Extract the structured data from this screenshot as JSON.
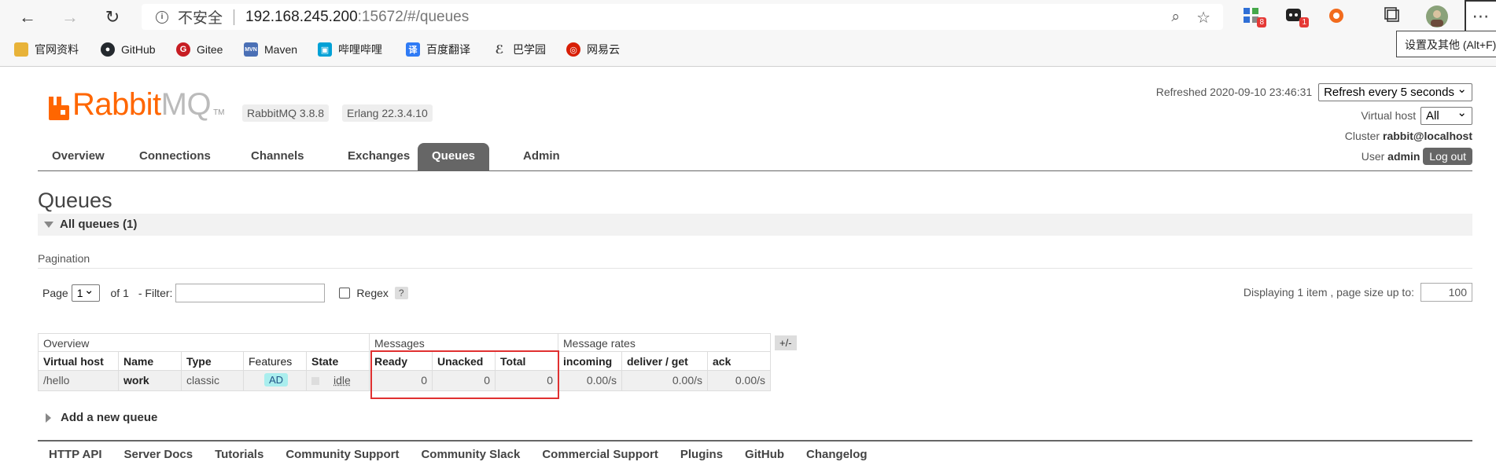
{
  "browser": {
    "address": {
      "security": "不安全",
      "host": "192.168.245.200",
      "path": ":15672/#/queues"
    },
    "extensions": [
      {
        "icon": "grid-app-icon",
        "badge": "8"
      },
      {
        "icon": "chat-icon",
        "badge": "1"
      },
      {
        "icon": "orange-circle-icon",
        "badge": ""
      }
    ],
    "menu_tooltip": "设置及其他 (Alt+F)",
    "bookmarks": [
      {
        "label": "官网资料",
        "icon": "folder-icon",
        "color": "#e8b339"
      },
      {
        "label": "GitHub",
        "icon": "github-icon",
        "color": "#24292e"
      },
      {
        "label": "Gitee",
        "icon": "gitee-icon",
        "color": "#c71d23"
      },
      {
        "label": "Maven",
        "icon": "maven-icon",
        "color": "#4a6fb5"
      },
      {
        "label": "哔哩哔哩",
        "icon": "bilibili-icon",
        "color": "#00a1d6"
      },
      {
        "label": "百度翻译",
        "icon": "translate-icon",
        "color": "#2f7bf5"
      },
      {
        "label": "巴学园",
        "icon": "bxy-icon",
        "color": "#444444"
      },
      {
        "label": "网易云",
        "icon": "netease-icon",
        "color": "#d81e06"
      }
    ]
  },
  "app": {
    "logo_main": "Rabbit",
    "logo_mq": "MQ",
    "logo_tm": "TM",
    "version": "RabbitMQ 3.8.8",
    "erlang": "Erlang 22.3.4.10",
    "refreshed_label": "Refreshed 2020-09-10 23:46:31",
    "refresh_select": "Refresh every 5 seconds",
    "vhost_label": "Virtual host",
    "vhost_select": "All",
    "cluster_label": "Cluster",
    "cluster_value": "rabbit@localhost",
    "user_label": "User",
    "user_value": "admin",
    "logout": "Log out",
    "brand_color": "#ff6600"
  },
  "tabs": [
    "Overview",
    "Connections",
    "Channels",
    "Exchanges",
    "Queues",
    "Admin"
  ],
  "page": {
    "title": "Queues",
    "section": "All queues (1)",
    "pagination_label": "Pagination",
    "page_label": "Page",
    "page_value": "1",
    "of_label": "of 1",
    "filter_label": "- Filter:",
    "regex_label": "Regex",
    "help": "?",
    "displaying": "Displaying 1 item , page size up to:",
    "page_size": "100",
    "add_queue": "Add a new queue"
  },
  "table": {
    "groups": [
      "Overview",
      "Messages",
      "Message rates"
    ],
    "plus_minus": "+/-",
    "columns": [
      "Virtual host",
      "Name",
      "Type",
      "Features",
      "State",
      "Ready",
      "Unacked",
      "Total",
      "incoming",
      "deliver / get",
      "ack"
    ],
    "rows": [
      {
        "vhost": "/hello",
        "name": "work",
        "type": "classic",
        "features": "AD",
        "state": "idle",
        "ready": "0",
        "unacked": "0",
        "total": "0",
        "incoming": "0.00/s",
        "deliver_get": "0.00/s",
        "ack": "0.00/s"
      }
    ]
  },
  "footer": [
    "HTTP API",
    "Server Docs",
    "Tutorials",
    "Community Support",
    "Community Slack",
    "Commercial Support",
    "Plugins",
    "GitHub",
    "Changelog"
  ]
}
